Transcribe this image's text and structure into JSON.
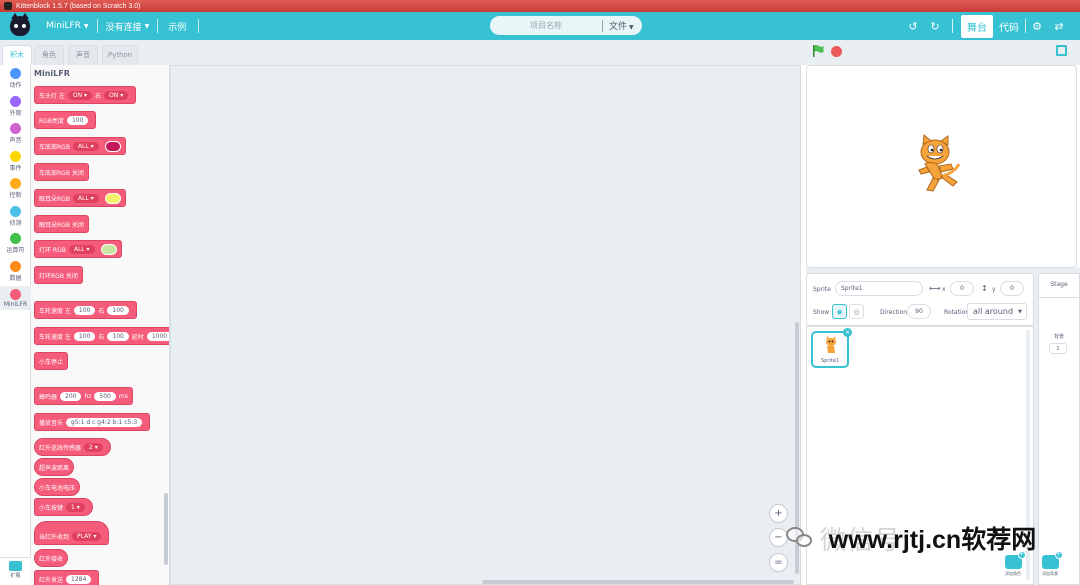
{
  "window": {
    "title": "Kittenblock 1.5.7 (based on Scratch 3.0)"
  },
  "menubar": {
    "device": "MiniLFR",
    "connection": "没有连接",
    "examples": "示例",
    "project_name_placeholder": "项目名称",
    "file_menu": "文件",
    "stage_tab": "舞台",
    "code_tab": "代码"
  },
  "editor_tabs": [
    "积木",
    "角色",
    "声音",
    "Python"
  ],
  "categories": [
    {
      "label": "动作",
      "color": "#4c97ff"
    },
    {
      "label": "外观",
      "color": "#9966ff"
    },
    {
      "label": "声音",
      "color": "#cf63cf"
    },
    {
      "label": "事件",
      "color": "#ffd500"
    },
    {
      "label": "控制",
      "color": "#ffab19"
    },
    {
      "label": "侦测",
      "color": "#4cbfe6"
    },
    {
      "label": "运算符",
      "color": "#40bf4a"
    },
    {
      "label": "数据",
      "color": "#ff8c1a"
    },
    {
      "label": "MiniLFR",
      "color": "#f55b7a"
    }
  ],
  "extension_label": "扩展",
  "palette": {
    "title": "MiniLFR",
    "block_color": "#f55b7a",
    "blocks": [
      {
        "text": "车头灯 左",
        "dd1": "ON",
        "mid": "右",
        "dd2": "ON"
      },
      {
        "text": "RGB亮度",
        "val": "100"
      },
      {
        "text": "车底部RGB",
        "dd": "ALL",
        "swatch": "#c2185b"
      },
      {
        "text": "车底部RGB 关闭"
      },
      {
        "text": "眼耳朵RGB",
        "dd": "ALL",
        "swatch": "#f4f06a"
      },
      {
        "text": "眼耳朵RGB 关闭"
      },
      {
        "text": "灯环 RGB",
        "dd": "ALL",
        "swatch": "#c8e6a0"
      },
      {
        "text": "灯环RGB 关闭"
      },
      {
        "text": "车轮速度 左",
        "v1": "100",
        "mid": "右",
        "v2": "100"
      },
      {
        "text": "车轮速度 左",
        "v1": "100",
        "mid": "右",
        "v2": "100",
        "mid2": "延时",
        "v3": "1000"
      },
      {
        "text": "小车停止"
      },
      {
        "text": "蜂鸣器",
        "v1": "200",
        "mid": "hz",
        "v2": "500",
        "unit": "ms"
      },
      {
        "text": "播放音乐",
        "val": "g5:1 d c g4:2 b:1 c5:3"
      },
      {
        "text": "红外巡线传感器",
        "dd": "2"
      },
      {
        "text": "超声波距离"
      },
      {
        "text": "小车电池电压"
      },
      {
        "text": "小车按键",
        "dd": "1"
      },
      {
        "text": "当红外收到",
        "dd": "PLAY"
      },
      {
        "text": "红外接收"
      },
      {
        "text": "红外发送",
        "val": "1284"
      }
    ]
  },
  "workspace": {
    "zoom_in": "+",
    "zoom_out": "−",
    "zoom_reset": "="
  },
  "sprite_info": {
    "sprite_label": "Sprite",
    "sprite_name": "Sprite1",
    "x_label": "x",
    "x_value": "0",
    "y_label": "y",
    "y_value": "0",
    "show_label": "Show",
    "direction_label": "Direction",
    "direction_value": "90",
    "rotation_label": "Rotation",
    "rotation_value": "all around"
  },
  "sprites": [
    {
      "name": "Sprite1"
    }
  ],
  "stage_panel": {
    "title": "Stage",
    "backdrops_label": "背景",
    "backdrops_count": "1"
  },
  "add_sprite_label": "添加角色",
  "add_backdrop_label": "添加背景",
  "watermark": {
    "cn": "微信号:",
    "url": "www.rjtj.cn软荐网"
  },
  "colors": {
    "accent": "#37c2d4",
    "titlebar": "#d9463f",
    "block": "#f55b7a"
  }
}
